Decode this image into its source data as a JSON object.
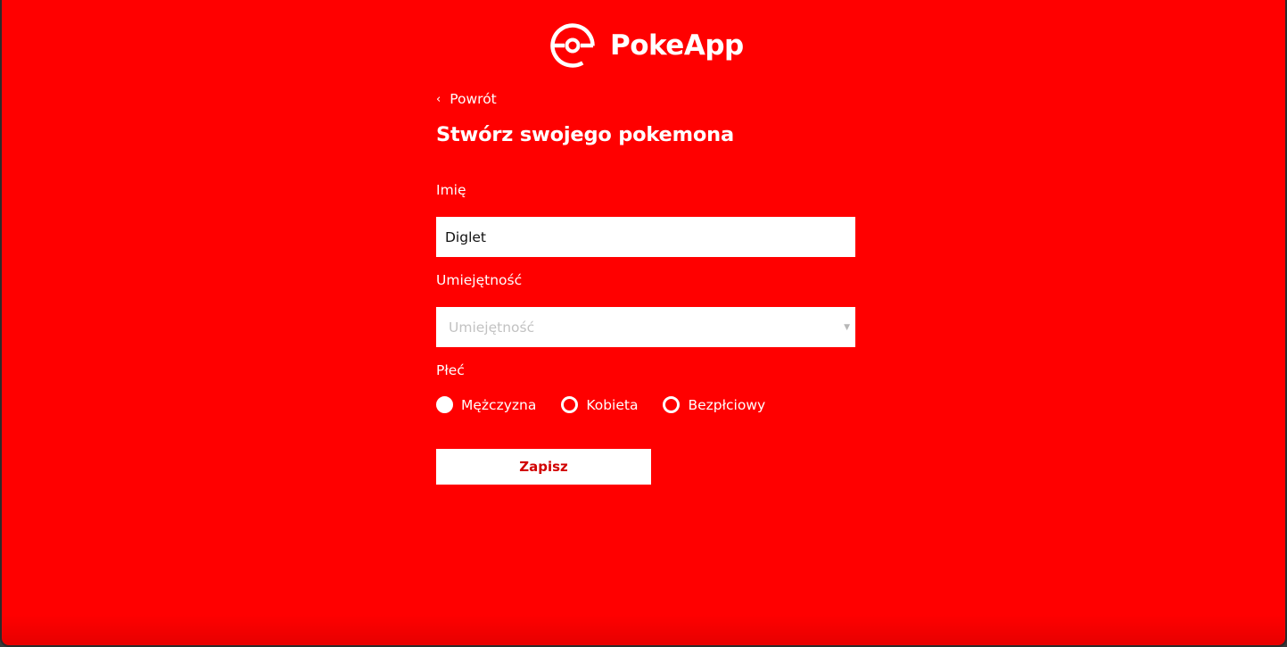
{
  "app": {
    "name": "PokeApp",
    "logo_icon": "pokeball-icon",
    "background_color": "#ff0000",
    "accent_text_color": "#d10000"
  },
  "nav": {
    "back_label": "Powrót",
    "back_icon": "chevron-left-icon"
  },
  "form": {
    "title": "Stwórz swojego pokemona",
    "name_label": "Imię",
    "name_value": "Diglet",
    "skill_label": "Umiejętność",
    "skill_placeholder": "Umiejętność",
    "skill_icon": "chevron-down-icon",
    "gender_label": "Płeć",
    "gender_options": [
      {
        "label": "Mężczyzna",
        "checked": true
      },
      {
        "label": "Kobieta",
        "checked": false
      },
      {
        "label": "Bezpłciowy",
        "checked": false
      }
    ],
    "submit_label": "Zapisz"
  }
}
